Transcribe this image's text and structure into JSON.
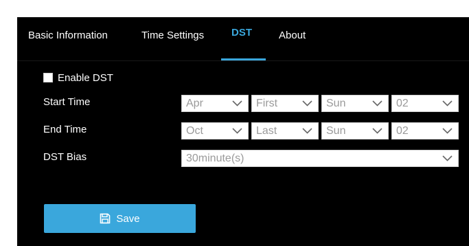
{
  "tabs": [
    {
      "label": "Basic Information",
      "active": false
    },
    {
      "label": "Time Settings",
      "active": false
    },
    {
      "label": "DST",
      "active": true
    },
    {
      "label": "About",
      "active": false
    }
  ],
  "enable_dst": {
    "label": "Enable DST",
    "checked": false
  },
  "start_time": {
    "label": "Start Time",
    "month": "Apr",
    "week": "First",
    "day": "Sun",
    "hour": "02"
  },
  "end_time": {
    "label": "End Time",
    "month": "Oct",
    "week": "Last",
    "day": "Sun",
    "hour": "02"
  },
  "dst_bias": {
    "label": "DST Bias",
    "value": "30minute(s)"
  },
  "save_button": {
    "label": "Save",
    "icon": "save-icon"
  },
  "colors": {
    "accent": "#3aa7dc",
    "background": "#000000",
    "select_text": "#9a9a9a"
  }
}
